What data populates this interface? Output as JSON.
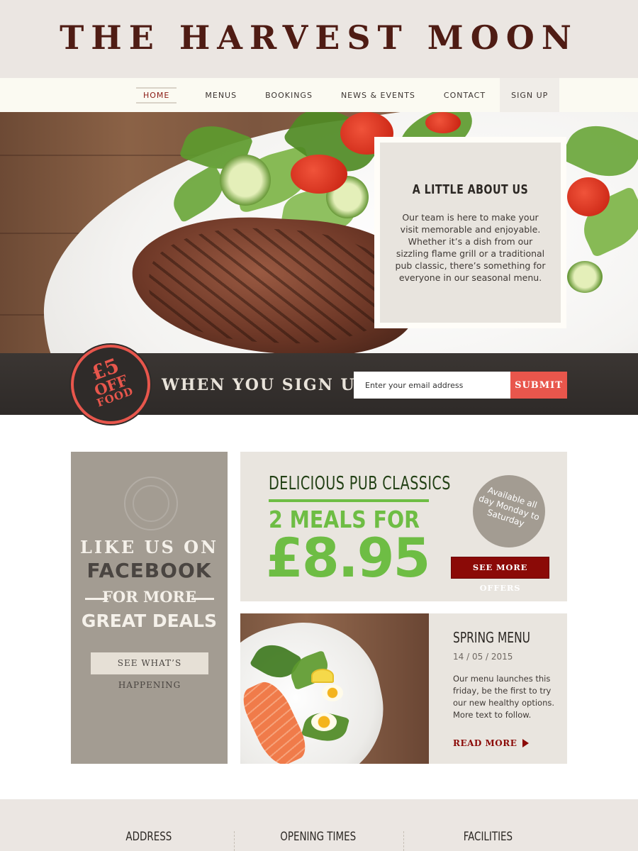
{
  "header": {
    "logo": "THE HARVEST MOON"
  },
  "nav": {
    "items": [
      {
        "label": "HOME"
      },
      {
        "label": "MENUS"
      },
      {
        "label": "BOOKINGS"
      },
      {
        "label": "NEWS & EVENTS"
      },
      {
        "label": "CONTACT"
      },
      {
        "label": "SIGN UP"
      }
    ],
    "active": "HOME"
  },
  "about": {
    "title": "A LITTLE ABOUT US",
    "text": "Our team is here to make your visit memorable and enjoyable. Whether it’s a dish from our sizzling flame grill or a traditional pub classic, there’s something for everyone in our seasonal menu."
  },
  "signup": {
    "badge_amount": "£5",
    "badge_off": "OFF",
    "badge_food": "FOOD",
    "headline": "WHEN YOU SIGN UP",
    "email_placeholder": "Enter your email address",
    "submit_label": "SUBMIT"
  },
  "facebook": {
    "line1": "LIKE US ON",
    "line2": "FACEBOOK",
    "line3": "FOR MORE",
    "line4": "GREAT DEALS",
    "button_label": "SEE WHAT’S HAPPENING"
  },
  "offer": {
    "title": "DELICIOUS PUB CLASSICS",
    "subtitle": "2 MEALS FOR",
    "price": "£8.95",
    "availability": "Available all day Monday to Saturday",
    "button_label": "SEE MORE OFFERS"
  },
  "spring": {
    "title": "SPRING MENU",
    "date": "14 / 05 / 2015",
    "description": "Our menu launches this friday, be the first to try our new healthy options. More text to follow.",
    "read_more": "READ MORE"
  },
  "footer": {
    "columns": [
      {
        "title": "ADDRESS"
      },
      {
        "title": "OPENING TIMES"
      },
      {
        "title": "FACILITIES"
      }
    ]
  },
  "colors": {
    "brand_dark": "#4f1c14",
    "accent_red": "#e8564c",
    "deep_red": "#8b0a07",
    "offer_green": "#6ebd44",
    "panel_taupe": "#a39c92",
    "panel_light": "#e9e5df"
  }
}
